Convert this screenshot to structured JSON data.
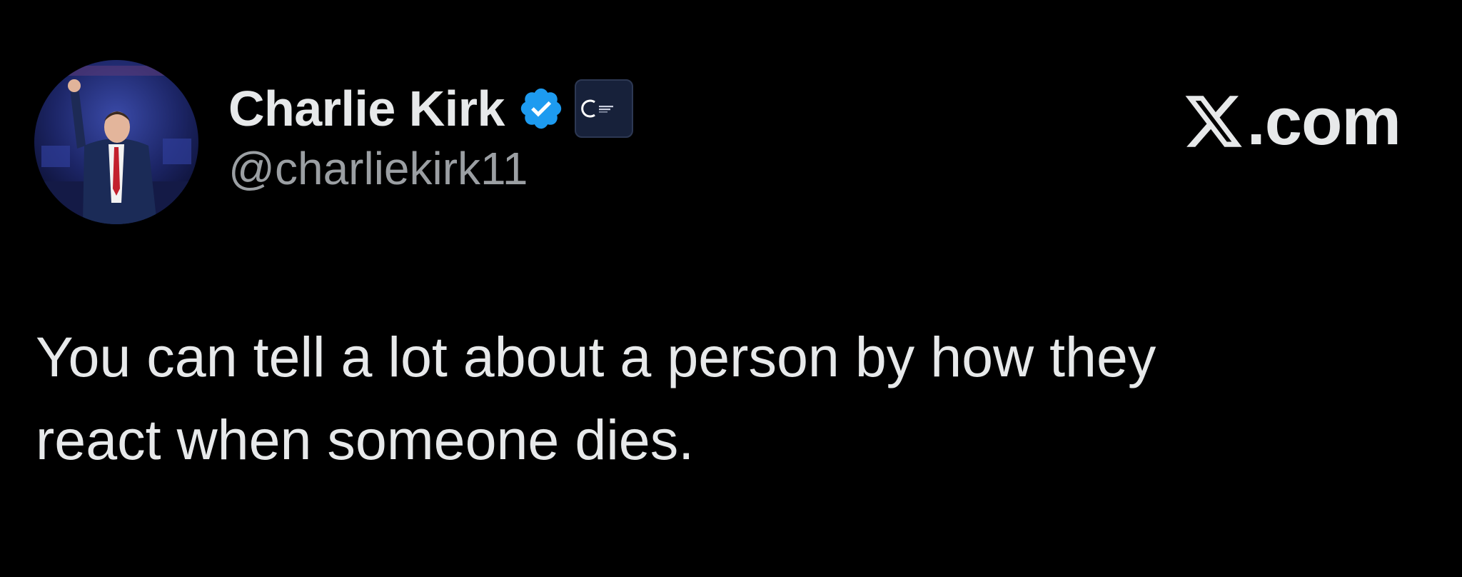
{
  "tweet": {
    "author": {
      "display_name": "Charlie Kirk",
      "handle": "@charliekirk11",
      "verified": true,
      "avatar_icon": "profile-photo",
      "affiliate_badge_icon": "organization-logo-icon"
    },
    "site": {
      "logo_icon": "x-logo-icon",
      "suffix": ".com"
    },
    "text_lines": [
      "You can tell a lot about a person by how they",
      "react when someone dies."
    ]
  },
  "colors": {
    "background": "#000000",
    "primary_text": "#e7e9ea",
    "secondary_text": "#9b9fa3",
    "verified_blue": "#1d9bf0",
    "affiliate_badge_bg": "#17213a"
  }
}
